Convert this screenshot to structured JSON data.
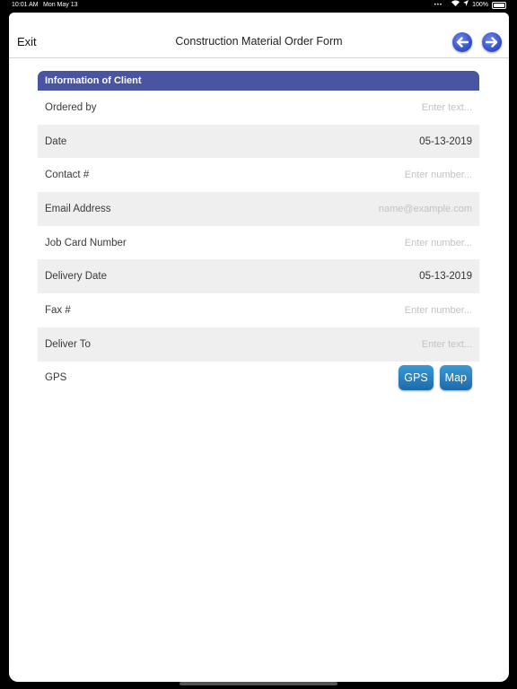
{
  "status_bar": {
    "time": "10:01 AM",
    "date": "Mon May 13",
    "dots": "•••",
    "battery": "100%"
  },
  "navbar": {
    "exit_label": "Exit",
    "title": "Construction Material Order Form",
    "back_icon": "arrow-left-icon",
    "forward_icon": "arrow-right-icon"
  },
  "section": {
    "title": "Information of Client"
  },
  "fields": [
    {
      "label": "Ordered by",
      "placeholder": "Enter text..."
    },
    {
      "label": "Date",
      "value": "05-13-2019"
    },
    {
      "label": "Contact #",
      "placeholder": "Enter number..."
    },
    {
      "label": "Email Address",
      "placeholder": "name@example.com"
    },
    {
      "label": "Job Card Number",
      "placeholder": "Enter number..."
    },
    {
      "label": "Delivery Date",
      "value": "05-13-2019"
    },
    {
      "label": "Fax #",
      "placeholder": "Enter number..."
    },
    {
      "label": "Deliver To",
      "placeholder": "Enter text..."
    },
    {
      "label": "GPS"
    }
  ],
  "gps_buttons": {
    "gps": "GPS",
    "map": "Map"
  },
  "colors": {
    "section_header": "#4a55a2",
    "nav_arrow": "#2d4bc4",
    "button_blue": "#1d6aa8",
    "row_alt": "#efefef"
  }
}
